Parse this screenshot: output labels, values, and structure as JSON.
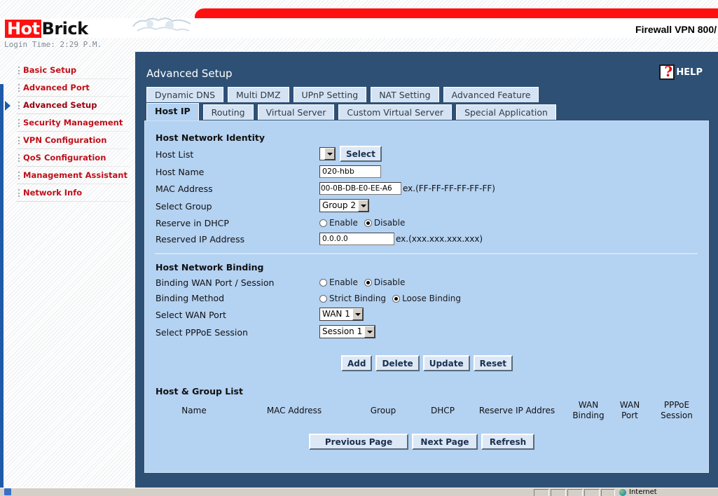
{
  "header": {
    "logo_hot": "Hot",
    "logo_brick": "Brick",
    "model_name": "Firewall VPN 800/",
    "login_time": "Login Time: 2:29 P.M."
  },
  "sidebar": {
    "items": [
      {
        "label": "Basic Setup"
      },
      {
        "label": "Advanced Port"
      },
      {
        "label": "Advanced Setup"
      },
      {
        "label": "Security Management"
      },
      {
        "label": "VPN Configuration"
      },
      {
        "label": "QoS Configuration"
      },
      {
        "label": "Management Assistant"
      },
      {
        "label": "Network Info"
      }
    ],
    "active_index": 2
  },
  "main": {
    "title": "Advanced Setup",
    "help_label": "HELP",
    "tabs_row1": [
      "Dynamic DNS",
      "Multi DMZ",
      "UPnP Setting",
      "NAT Setting",
      "Advanced Feature"
    ],
    "tabs_row2": [
      "Host IP",
      "Routing",
      "Virtual Server",
      "Custom Virtual Server",
      "Special Application"
    ],
    "active_tab": "Host IP"
  },
  "identity": {
    "heading": "Host Network Identity",
    "host_list_label": "Host List",
    "host_list_value": "",
    "select_button": "Select",
    "host_name_label": "Host Name",
    "host_name_value": "020-hbb",
    "mac_label": "MAC Address",
    "mac_value": "00-0B-DB-E0-EE-A6",
    "mac_hint": "ex.(FF-FF-FF-FF-FF-FF)",
    "group_label": "Select Group",
    "group_value": "Group 2",
    "dhcp_label": "Reserve in DHCP",
    "dhcp_options": [
      "Enable",
      "Disable"
    ],
    "dhcp_selected": "Disable",
    "reserved_ip_label": "Reserved IP Address",
    "reserved_ip_value": "0.0.0.0",
    "reserved_ip_hint": "ex.(xxx.xxx.xxx.xxx)"
  },
  "binding": {
    "heading": "Host Network Binding",
    "wan_session_label": "Binding WAN Port / Session",
    "wan_session_options": [
      "Enable",
      "Disable"
    ],
    "wan_session_selected": "Disable",
    "method_label": "Binding Method",
    "method_options": [
      "Strict Binding",
      "Loose Binding"
    ],
    "method_selected": "Loose Binding",
    "wan_port_label": "Select WAN Port",
    "wan_port_value": "WAN 1",
    "pppoe_label": "Select PPPoE Session",
    "pppoe_value": "Session 1"
  },
  "actions": {
    "add": "Add",
    "delete": "Delete",
    "update": "Update",
    "reset": "Reset"
  },
  "host_list": {
    "heading": "Host & Group List",
    "columns": [
      "Name",
      "MAC Address",
      "Group",
      "DHCP",
      "Reserve IP Addres",
      "WAN Binding",
      "WAN Port",
      "PPPoE Session"
    ],
    "rows": []
  },
  "pager": {
    "previous": "Previous Page",
    "next": "Next Page",
    "refresh": "Refresh"
  },
  "statusbar": {
    "zone": "Internet"
  },
  "colors": {
    "panel_bg": "#2e5075",
    "content_bg": "#b4d2f2",
    "nav_text": "#c0101a",
    "brand_red": "#ff1010"
  }
}
